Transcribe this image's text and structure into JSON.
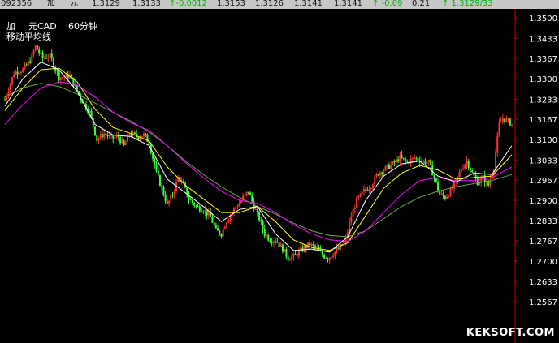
{
  "quote_bar": {
    "code": "092356",
    "name_a": "加",
    "name_b": "元",
    "open": "1.3129",
    "prev_close": "1.3133",
    "change": "↑-0.0012",
    "high": "1.3153",
    "low": "1.3126",
    "last": "1.3141",
    "bid": "1.3141",
    "change_pct": "↑ -0.09",
    "amplitude": "0.21",
    "time_price": "↑ 1.3129/33",
    "colors": {
      "up": "#00b000",
      "normal": "#111111"
    }
  },
  "chart_header": {
    "symbol_prefix": "加",
    "symbol": "元CAD",
    "period": "60分钟",
    "indicator": "移动平均线"
  },
  "watermark": "KEKSOFT.COM",
  "chart_data": {
    "type": "candlestick",
    "title": "加 元CAD 60分钟",
    "subtitle": "移动平均线",
    "ylim": [
      1.25,
      1.353
    ],
    "y_ticks": [
      "1.3500",
      "1.3433",
      "1.3367",
      "1.3300",
      "1.3233",
      "1.3167",
      "1.3100",
      "1.3033",
      "1.2967",
      "1.2900",
      "1.2833",
      "1.2767",
      "1.2700",
      "1.2633",
      "1.2567"
    ],
    "colors": {
      "up": "#ff3030",
      "down": "#38ff38",
      "ma_short": "#ffffff",
      "ma_mid": "#ffff00",
      "ma_long": "#ff00ff",
      "ma_slow": "#6aaa40",
      "axis": "#d00000"
    },
    "path_points": [
      [
        0,
        1.3232
      ],
      [
        5,
        1.332
      ],
      [
        10,
        1.333
      ],
      [
        14,
        1.336
      ],
      [
        17,
        1.3406
      ],
      [
        21,
        1.3368
      ],
      [
        25,
        1.3376
      ],
      [
        30,
        1.3305
      ],
      [
        36,
        1.331
      ],
      [
        40,
        1.326
      ],
      [
        44,
        1.3215
      ],
      [
        47,
        1.319
      ],
      [
        51,
        1.31
      ],
      [
        55,
        1.312
      ],
      [
        59,
        1.3105
      ],
      [
        63,
        1.3108
      ],
      [
        66,
        1.3078
      ],
      [
        69,
        1.312
      ],
      [
        73,
        1.311
      ],
      [
        77,
        1.3115
      ],
      [
        80,
        1.309
      ],
      [
        84,
        1.299
      ],
      [
        87,
        1.294
      ],
      [
        90,
        1.2885
      ],
      [
        93,
        1.292
      ],
      [
        96,
        1.2975
      ],
      [
        99,
        1.295
      ],
      [
        102,
        1.2905
      ],
      [
        106,
        1.288
      ],
      [
        110,
        1.287
      ],
      [
        114,
        1.2845
      ],
      [
        117,
        1.28
      ],
      [
        120,
        1.279
      ],
      [
        123,
        1.2835
      ],
      [
        127,
        1.287
      ],
      [
        131,
        1.29
      ],
      [
        135,
        1.293
      ],
      [
        138,
        1.288
      ],
      [
        141,
        1.284
      ],
      [
        144,
        1.279
      ],
      [
        147,
        1.277
      ],
      [
        150,
        1.277
      ],
      [
        154,
        1.274
      ],
      [
        157,
        1.271
      ],
      [
        160,
        1.2715
      ],
      [
        163,
        1.273
      ],
      [
        166,
        1.2745
      ],
      [
        169,
        1.2755
      ],
      [
        173,
        1.274
      ],
      [
        176,
        1.272
      ],
      [
        179,
        1.271
      ],
      [
        182,
        1.2725
      ],
      [
        185,
        1.274
      ],
      [
        189,
        1.277
      ],
      [
        192,
        1.285
      ],
      [
        195,
        1.29
      ],
      [
        199,
        1.293
      ],
      [
        203,
        1.295
      ],
      [
        207,
        1.299
      ],
      [
        211,
        1.3005
      ],
      [
        215,
        1.302
      ],
      [
        219,
        1.304
      ],
      [
        223,
        1.3025
      ],
      [
        227,
        1.304
      ],
      [
        231,
        1.303
      ],
      [
        235,
        1.3025
      ],
      [
        238,
        1.2975
      ],
      [
        241,
        1.292
      ],
      [
        244,
        1.291
      ],
      [
        247,
        1.293
      ],
      [
        250,
        1.296
      ],
      [
        253,
        1.3005
      ],
      [
        256,
        1.303
      ],
      [
        259,
        1.299
      ],
      [
        262,
        1.296
      ],
      [
        265,
        1.2975
      ],
      [
        268,
        1.295
      ],
      [
        271,
        1.301
      ],
      [
        274,
        1.315
      ],
      [
        276,
        1.317
      ],
      [
        279,
        1.316
      ],
      [
        281,
        1.315
      ]
    ],
    "ma_short": [
      [
        0,
        1.321
      ],
      [
        10,
        1.33
      ],
      [
        20,
        1.3355
      ],
      [
        30,
        1.333
      ],
      [
        40,
        1.326
      ],
      [
        50,
        1.315
      ],
      [
        60,
        1.3115
      ],
      [
        70,
        1.311
      ],
      [
        80,
        1.308
      ],
      [
        90,
        1.297
      ],
      [
        100,
        1.2925
      ],
      [
        110,
        1.288
      ],
      [
        120,
        1.283
      ],
      [
        130,
        1.287
      ],
      [
        140,
        1.288
      ],
      [
        150,
        1.279
      ],
      [
        160,
        1.2735
      ],
      [
        170,
        1.274
      ],
      [
        180,
        1.273
      ],
      [
        190,
        1.278
      ],
      [
        200,
        1.29
      ],
      [
        210,
        1.298
      ],
      [
        220,
        1.302
      ],
      [
        230,
        1.303
      ],
      [
        240,
        1.298
      ],
      [
        250,
        1.296
      ],
      [
        260,
        1.299
      ],
      [
        270,
        1.2985
      ],
      [
        281,
        1.308
      ]
    ],
    "ma_mid": [
      [
        0,
        1.3195
      ],
      [
        10,
        1.327
      ],
      [
        20,
        1.333
      ],
      [
        30,
        1.3335
      ],
      [
        40,
        1.329
      ],
      [
        50,
        1.32
      ],
      [
        60,
        1.314
      ],
      [
        70,
        1.312
      ],
      [
        80,
        1.3095
      ],
      [
        90,
        1.301
      ],
      [
        100,
        1.295
      ],
      [
        110,
        1.2905
      ],
      [
        120,
        1.286
      ],
      [
        130,
        1.286
      ],
      [
        140,
        1.288
      ],
      [
        150,
        1.283
      ],
      [
        160,
        1.277
      ],
      [
        170,
        1.2745
      ],
      [
        180,
        1.2735
      ],
      [
        190,
        1.276
      ],
      [
        200,
        1.285
      ],
      [
        210,
        1.294
      ],
      [
        220,
        1.299
      ],
      [
        230,
        1.3015
      ],
      [
        240,
        1.3
      ],
      [
        250,
        1.297
      ],
      [
        260,
        1.2975
      ],
      [
        270,
        1.298
      ],
      [
        281,
        1.305
      ]
    ],
    "ma_long": [
      [
        0,
        1.315
      ],
      [
        10,
        1.3215
      ],
      [
        20,
        1.327
      ],
      [
        30,
        1.329
      ],
      [
        40,
        1.328
      ],
      [
        50,
        1.324
      ],
      [
        60,
        1.319
      ],
      [
        70,
        1.3155
      ],
      [
        80,
        1.313
      ],
      [
        90,
        1.308
      ],
      [
        100,
        1.3025
      ],
      [
        110,
        1.2975
      ],
      [
        120,
        1.293
      ],
      [
        130,
        1.29
      ],
      [
        140,
        1.289
      ],
      [
        150,
        1.286
      ],
      [
        160,
        1.282
      ],
      [
        170,
        1.279
      ],
      [
        180,
        1.277
      ],
      [
        190,
        1.2765
      ],
      [
        200,
        1.28
      ],
      [
        210,
        1.286
      ],
      [
        220,
        1.292
      ],
      [
        230,
        1.2965
      ],
      [
        240,
        1.2975
      ],
      [
        250,
        1.2965
      ],
      [
        260,
        1.2965
      ],
      [
        270,
        1.2975
      ],
      [
        281,
        1.301
      ]
    ],
    "ma_slow": [
      [
        0,
        1.324
      ],
      [
        10,
        1.327
      ],
      [
        20,
        1.3285
      ],
      [
        30,
        1.3275
      ],
      [
        40,
        1.325
      ],
      [
        50,
        1.322
      ],
      [
        60,
        1.319
      ],
      [
        70,
        1.316
      ],
      [
        80,
        1.3125
      ],
      [
        90,
        1.308
      ],
      [
        100,
        1.303
      ],
      [
        110,
        1.2985
      ],
      [
        120,
        1.2945
      ],
      [
        130,
        1.291
      ],
      [
        140,
        1.288
      ],
      [
        150,
        1.2855
      ],
      [
        160,
        1.2825
      ],
      [
        170,
        1.28
      ],
      [
        180,
        1.2785
      ],
      [
        190,
        1.278
      ],
      [
        200,
        1.28
      ],
      [
        210,
        1.284
      ],
      [
        220,
        1.288
      ],
      [
        230,
        1.291
      ],
      [
        240,
        1.293
      ],
      [
        250,
        1.2945
      ],
      [
        260,
        1.2955
      ],
      [
        270,
        1.2965
      ],
      [
        281,
        1.2985
      ]
    ]
  }
}
